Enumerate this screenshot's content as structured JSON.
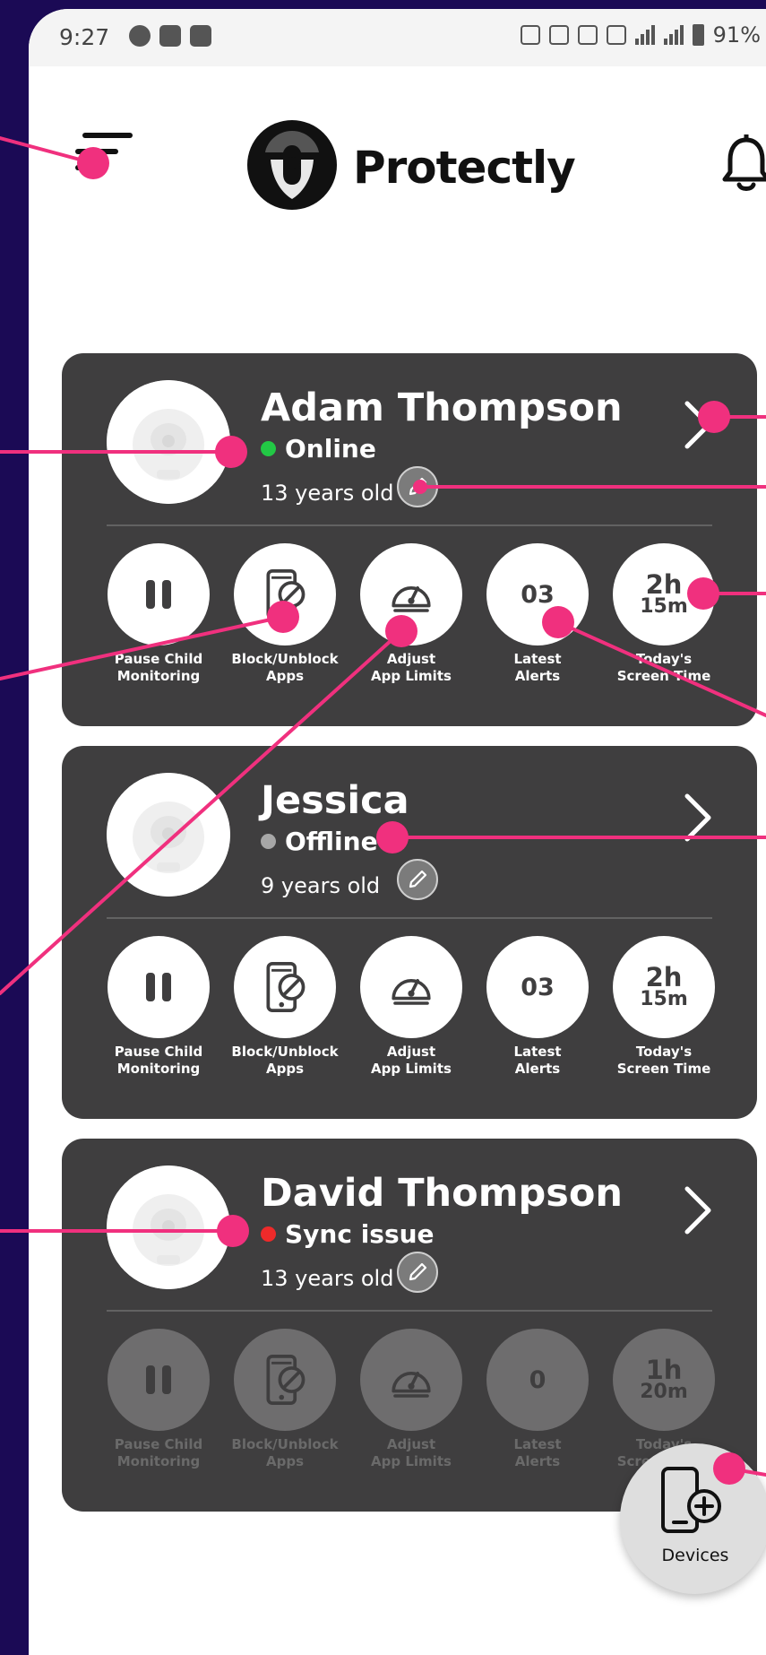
{
  "status_bar": {
    "time": "9:27",
    "battery": "91%"
  },
  "header": {
    "brand": "Protectly"
  },
  "colors": {
    "accent": "#f0307e",
    "online": "#22c845",
    "offline": "#a7a7a7",
    "sync_issue": "#ee2a2a",
    "card": "#3f3e3f",
    "frame": "#1b0a55"
  },
  "icons": [
    "menu-icon",
    "logo-icon",
    "bell-icon",
    "pause-icon",
    "block-apps-icon",
    "gauge-icon",
    "pencil-icon",
    "chevron-right-icon",
    "add-device-icon"
  ],
  "children": [
    {
      "name": "Adam Thompson",
      "status": "Online",
      "status_color": "#22c845",
      "age": "13 years old",
      "latest_alerts": "03",
      "screen_time_h": "2h",
      "screen_time_m": "15m",
      "enabled": true
    },
    {
      "name": "Jessica",
      "status": "Offline",
      "status_color": "#a7a7a7",
      "age": "9 years old",
      "latest_alerts": "03",
      "screen_time_h": "2h",
      "screen_time_m": "15m",
      "enabled": true
    },
    {
      "name": "David Thompson",
      "status": "Sync issue",
      "status_color": "#ee2a2a",
      "age": "13 years old",
      "latest_alerts": "0",
      "screen_time_h": "1h",
      "screen_time_m": "20m",
      "enabled": false
    }
  ],
  "action_labels": {
    "pause_1": "Pause Child",
    "pause_2": "Monitoring",
    "block_1": "Block/Unblock",
    "block_2": "Apps",
    "limits_1": "Adjust",
    "limits_2": "App Limits",
    "alerts_1": "Latest",
    "alerts_2": "Alerts",
    "screen_1": "Today's",
    "screen_2": "Screen Time"
  },
  "fab": {
    "label": "Devices"
  }
}
